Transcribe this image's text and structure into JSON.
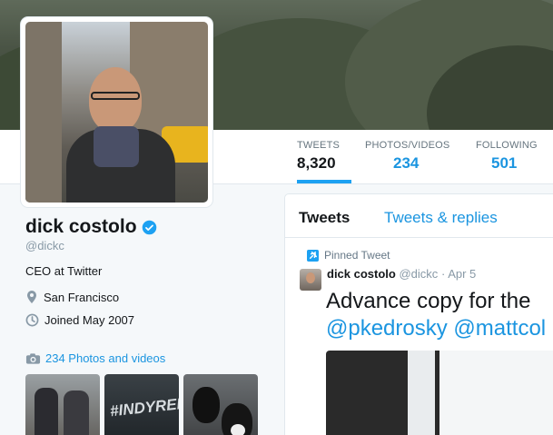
{
  "nav": {
    "tweets_label": "TWEETS",
    "tweets_count": "8,320",
    "photos_label": "PHOTOS/VIDEOS",
    "photos_count": "234",
    "following_label": "FOLLOWING",
    "following_count": "501"
  },
  "profile": {
    "name": "dick costolo",
    "handle": "@dickc",
    "bio": "CEO at Twitter",
    "location": "San Francisco",
    "joined": "Joined May 2007",
    "photos_link": "234 Photos and videos",
    "thumb_2_text": "#INDYREF"
  },
  "timeline": {
    "tab_tweets": "Tweets",
    "tab_replies": "Tweets & replies",
    "pinned_label": "Pinned Tweet",
    "tweet_name": "dick costolo",
    "tweet_handle": "@dickc",
    "tweet_dot": "·",
    "tweet_date": "Apr 5",
    "tweet_text": "Advance copy for the",
    "tweet_mentions": "@pkedrosky @mattcol"
  },
  "icons": {
    "verified": "verified-badge-icon",
    "location": "map-pin-icon",
    "joined": "clock-icon",
    "photos": "camera-icon",
    "pinned": "pin-icon"
  },
  "colors": {
    "accent": "#1da1f2",
    "link": "#1b95e0",
    "text": "#14171a",
    "muted": "#8899a6"
  }
}
